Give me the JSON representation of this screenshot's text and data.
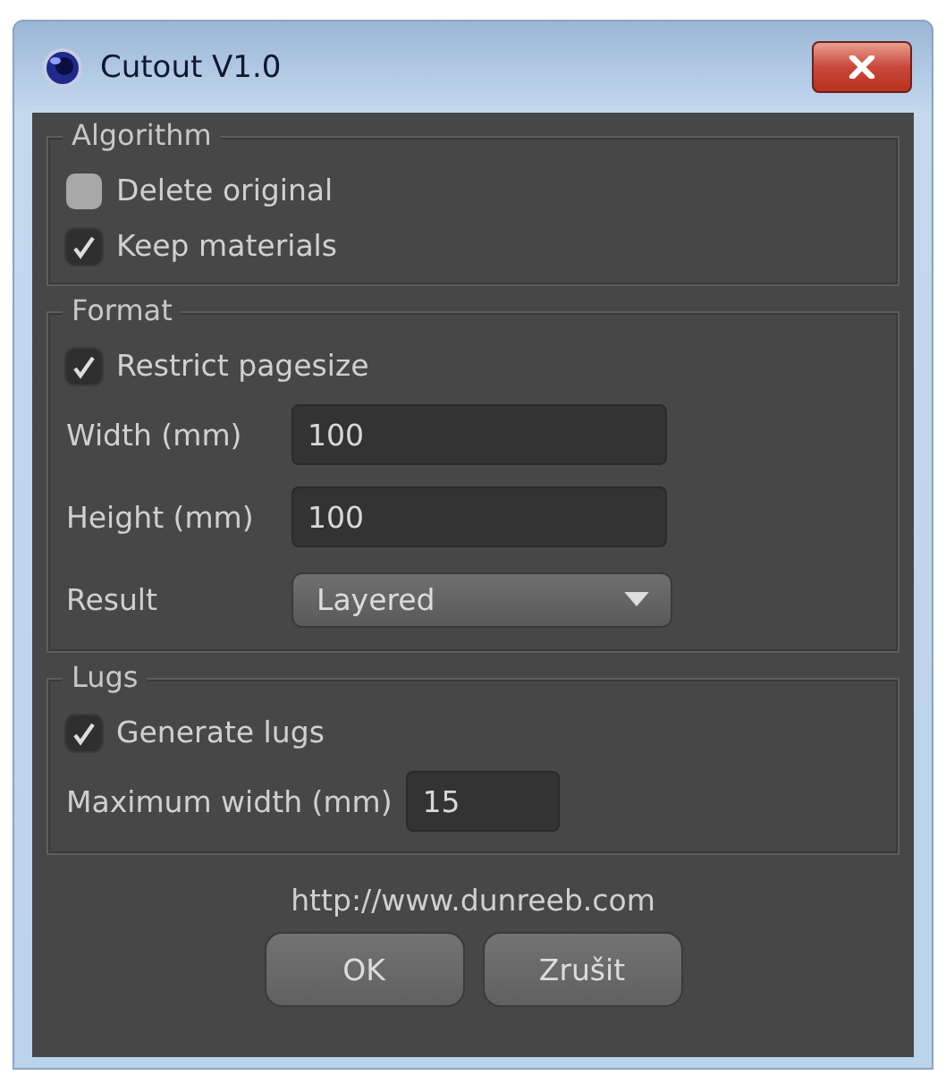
{
  "window": {
    "title": "Cutout V1.0"
  },
  "groups": [
    {
      "title": "Algorithm",
      "items": [
        {
          "kind": "checkbox",
          "label": "Delete original",
          "checked": false
        },
        {
          "kind": "checkbox",
          "label": "Keep materials",
          "checked": true
        }
      ]
    },
    {
      "title": "Format",
      "items": [
        {
          "kind": "checkbox",
          "label": "Restrict pagesize",
          "checked": true
        },
        {
          "kind": "field",
          "label": "Width (mm)",
          "value": "100"
        },
        {
          "kind": "field",
          "label": "Height (mm)",
          "value": "100"
        },
        {
          "kind": "dropdown",
          "label": "Result",
          "value": "Layered"
        }
      ]
    },
    {
      "title": "Lugs",
      "items": [
        {
          "kind": "checkbox",
          "label": "Generate lugs",
          "checked": true
        },
        {
          "kind": "short-field",
          "label": "Maximum width (mm)",
          "value": "15"
        }
      ]
    }
  ],
  "link": "http://www.dunreeb.com",
  "buttons": [
    "OK",
    "Zrušit"
  ]
}
